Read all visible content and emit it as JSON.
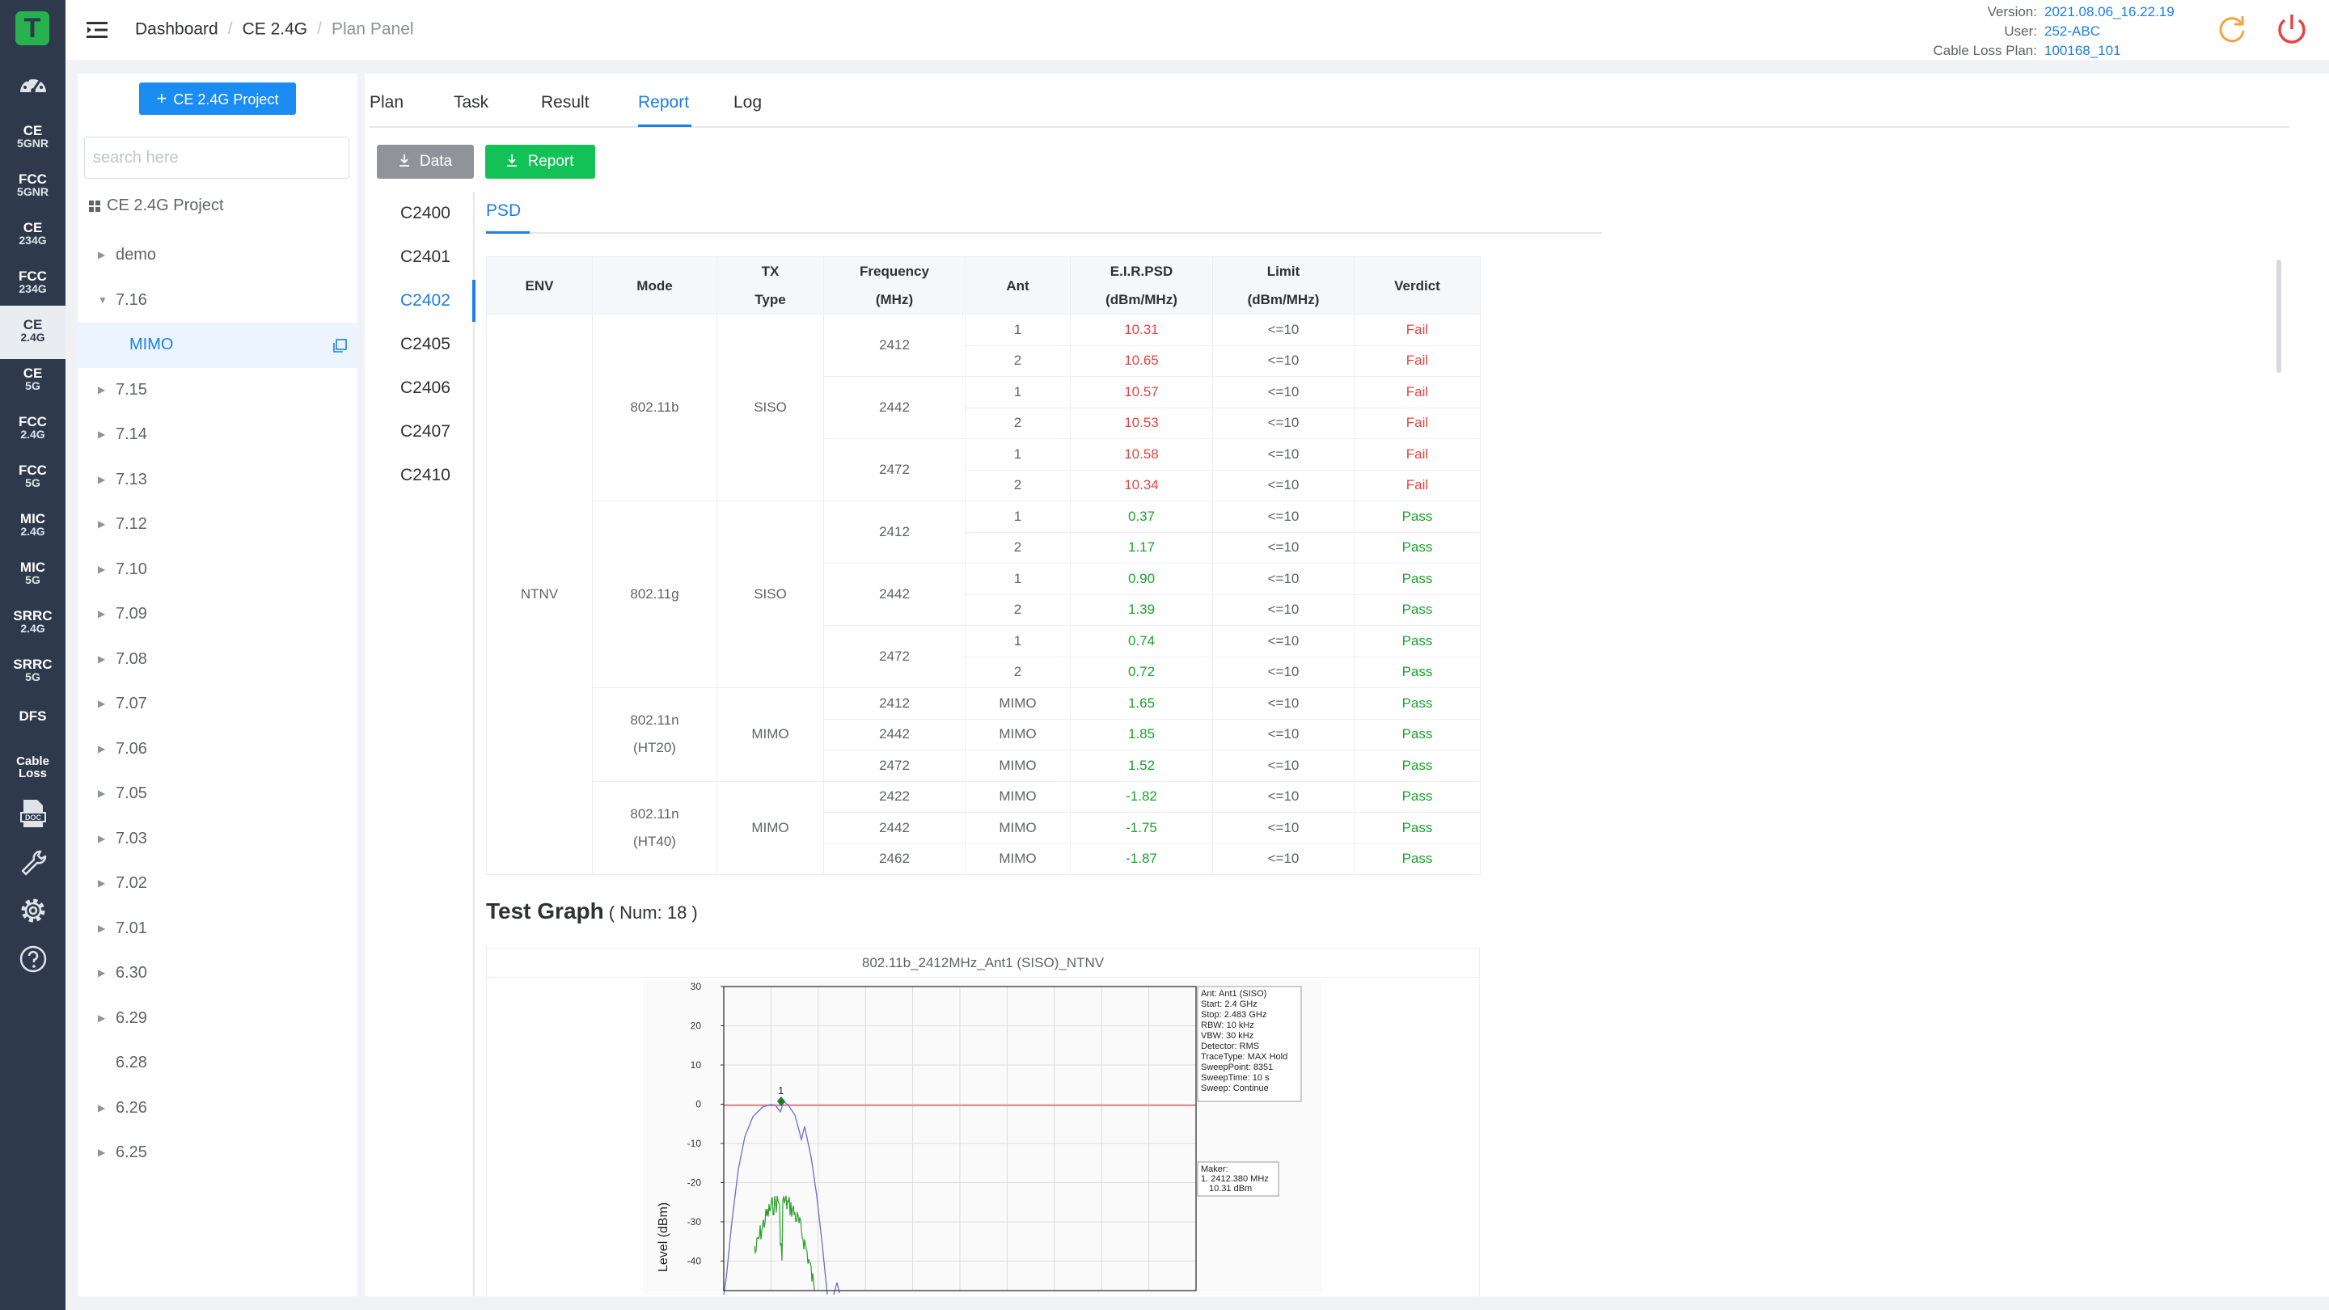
{
  "rail": {
    "items": [
      {
        "l1": "CE",
        "l2": "5GNR"
      },
      {
        "l1": "FCC",
        "l2": "5GNR"
      },
      {
        "l1": "CE",
        "l2": "234G"
      },
      {
        "l1": "FCC",
        "l2": "234G"
      },
      {
        "l1": "CE",
        "l2": "2.4G"
      },
      {
        "l1": "CE",
        "l2": "5G"
      },
      {
        "l1": "FCC",
        "l2": "2.4G"
      },
      {
        "l1": "FCC",
        "l2": "5G"
      },
      {
        "l1": "MIC",
        "l2": "2.4G"
      },
      {
        "l1": "MIC",
        "l2": "5G"
      },
      {
        "l1": "SRRC",
        "l2": "2.4G"
      },
      {
        "l1": "SRRC",
        "l2": "5G"
      },
      {
        "l1": "DFS",
        "l2": ""
      },
      {
        "l1": "Cable",
        "l2": "Loss"
      }
    ],
    "logo": "T"
  },
  "header": {
    "breadcrumb": [
      "Dashboard",
      "CE 2.4G",
      "Plan Panel"
    ],
    "version_label": "Version:",
    "version": "2021.08.06_16.22.19",
    "user_label": "User:",
    "user": "252-ABC",
    "cable_label": "Cable Loss Plan:",
    "cable": "100168_101"
  },
  "tree": {
    "project_button": "CE 2.4G Project",
    "search_placeholder": "search here",
    "root": "CE 2.4G Project",
    "nodes": [
      "demo",
      "7.16",
      "MIMO",
      "7.15",
      "7.14",
      "7.13",
      "7.12",
      "7.10",
      "7.09",
      "7.08",
      "7.07",
      "7.06",
      "7.05",
      "7.03",
      "7.02",
      "7.01",
      "6.30",
      "6.29",
      "6.28",
      "6.26",
      "6.25"
    ]
  },
  "tabs": [
    "Plan",
    "Task",
    "Result",
    "Report",
    "Log"
  ],
  "active_tab": "Report",
  "buttons": {
    "data": "Data",
    "report": "Report"
  },
  "sub_items": [
    "C2400",
    "C2401",
    "C2402",
    "C2405",
    "C2406",
    "C2407",
    "C2410"
  ],
  "active_sub": "C2402",
  "psd_tab": "PSD",
  "table": {
    "headers": {
      "env": "ENV",
      "mode": "Mode",
      "tx1": "TX",
      "tx2": "Type",
      "freq1": "Frequency",
      "freq2": "(MHz)",
      "ant": "Ant",
      "eirp1": "E.I.R.PSD",
      "eirp2": "(dBm/MHz)",
      "limit1": "Limit",
      "limit2": "(dBm/MHz)",
      "verdict": "Verdict"
    },
    "env": "NTNV",
    "modes": [
      {
        "mode": "802.11b",
        "tx": "SISO"
      },
      {
        "mode": "802.11g",
        "tx": "SISO"
      },
      {
        "mode": "802.11n",
        "mode2": "(HT20)",
        "tx": "MIMO"
      },
      {
        "mode": "802.11n",
        "mode2": "(HT40)",
        "tx": "MIMO"
      }
    ],
    "freqs": [
      "2412",
      "2442",
      "2472",
      "2412",
      "2442",
      "2472"
    ],
    "rows": [
      {
        "freq": "2412",
        "ant": "1",
        "psd": "10.31",
        "limit": "<=10",
        "verdict": "Fail"
      },
      {
        "freq": "2412",
        "ant": "2",
        "psd": "10.65",
        "limit": "<=10",
        "verdict": "Fail"
      },
      {
        "freq": "2442",
        "ant": "1",
        "psd": "10.57",
        "limit": "<=10",
        "verdict": "Fail"
      },
      {
        "freq": "2442",
        "ant": "2",
        "psd": "10.53",
        "limit": "<=10",
        "verdict": "Fail"
      },
      {
        "freq": "2472",
        "ant": "1",
        "psd": "10.58",
        "limit": "<=10",
        "verdict": "Fail"
      },
      {
        "freq": "2472",
        "ant": "2",
        "psd": "10.34",
        "limit": "<=10",
        "verdict": "Fail"
      },
      {
        "freq": "2412",
        "ant": "1",
        "psd": "0.37",
        "limit": "<=10",
        "verdict": "Pass"
      },
      {
        "freq": "2412",
        "ant": "2",
        "psd": "1.17",
        "limit": "<=10",
        "verdict": "Pass"
      },
      {
        "freq": "2442",
        "ant": "1",
        "psd": "0.90",
        "limit": "<=10",
        "verdict": "Pass"
      },
      {
        "freq": "2442",
        "ant": "2",
        "psd": "1.39",
        "limit": "<=10",
        "verdict": "Pass"
      },
      {
        "freq": "2472",
        "ant": "1",
        "psd": "0.74",
        "limit": "<=10",
        "verdict": "Pass"
      },
      {
        "freq": "2472",
        "ant": "2",
        "psd": "0.72",
        "limit": "<=10",
        "verdict": "Pass"
      },
      {
        "freq": "2412",
        "ant": "MIMO",
        "psd": "1.65",
        "limit": "<=10",
        "verdict": "Pass"
      },
      {
        "freq": "2442",
        "ant": "MIMO",
        "psd": "1.85",
        "limit": "<=10",
        "verdict": "Pass"
      },
      {
        "freq": "2472",
        "ant": "MIMO",
        "psd": "1.52",
        "limit": "<=10",
        "verdict": "Pass"
      },
      {
        "freq": "2422",
        "ant": "MIMO",
        "psd": "-1.82",
        "limit": "<=10",
        "verdict": "Pass"
      },
      {
        "freq": "2442",
        "ant": "MIMO",
        "psd": "-1.75",
        "limit": "<=10",
        "verdict": "Pass"
      },
      {
        "freq": "2462",
        "ant": "MIMO",
        "psd": "-1.87",
        "limit": "<=10",
        "verdict": "Pass"
      }
    ]
  },
  "graph": {
    "title": "Test Graph",
    "num": "( Num: 18 )",
    "plot_title": "802.11b_2412MHz_Ant1 (SISO)_NTNV",
    "ylabel": "Level (dBm)",
    "yticks": [
      "30",
      "20",
      "10",
      "0",
      "-10",
      "-20",
      "-30",
      "-40"
    ],
    "marker_label": "1",
    "info": [
      "Ant: Ant1 (SISO)",
      "Start: 2.4 GHz",
      "Stop: 2.483 GHz",
      "RBW: 10 kHz",
      "VBW: 30 kHz",
      "Detector: RMS",
      "TraceType: MAX Hold",
      "SweepPoint: 8351",
      "SweepTime: 10 s",
      "Sweep: Continue"
    ],
    "maker": [
      "Maker:",
      "1. 2412.380 MHz",
      "   10.31 dBm"
    ],
    "colors": {
      "trace": "#6b6bd9",
      "inner": "#2ca02c",
      "limit": "#e24a4a"
    }
  },
  "colors": {
    "accent": "#1d7ee6",
    "rail": "#2e3a4c",
    "fail": "#e84343",
    "pass": "#1aa32c",
    "logo": "#27b14f"
  }
}
